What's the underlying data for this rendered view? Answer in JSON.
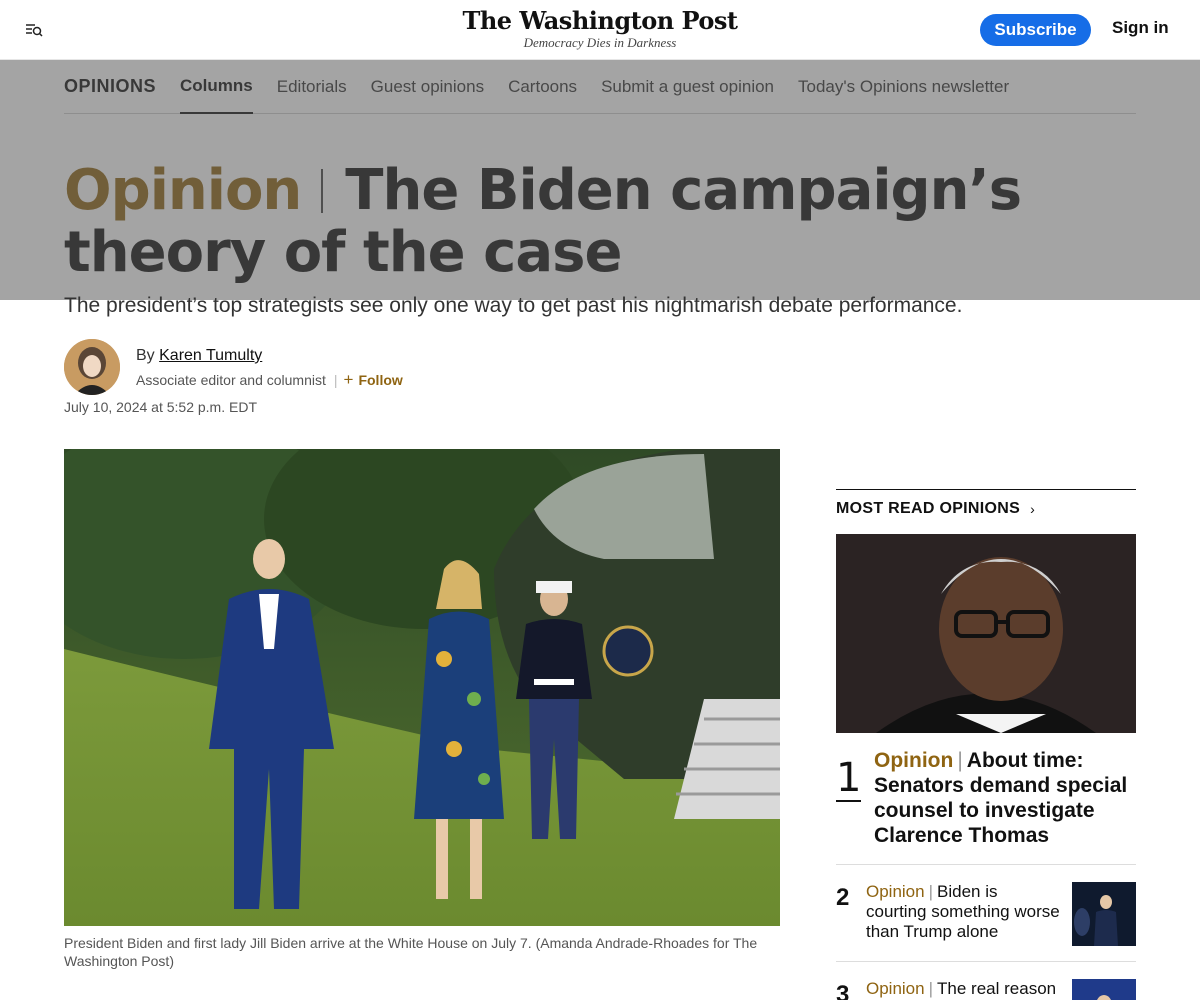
{
  "header": {
    "logo": "The Washington Post",
    "tagline": "Democracy Dies in Darkness",
    "subscribe_label": "Subscribe",
    "signin_label": "Sign in"
  },
  "section_nav": {
    "title": "OPINIONS",
    "items": [
      {
        "label": "Columns",
        "active": true
      },
      {
        "label": "Editorials"
      },
      {
        "label": "Guest opinions"
      },
      {
        "label": "Cartoons"
      },
      {
        "label": "Submit a guest opinion"
      },
      {
        "label": "Today's Opinions newsletter"
      }
    ]
  },
  "article": {
    "kicker": "Opinion",
    "headline": "The Biden campaign’s theory of the case",
    "dek": "The president’s top strategists see only one way to get past his nightmarish debate performance.",
    "byline_prefix": "By",
    "author": "Karen Tumulty",
    "role": "Associate editor and columnist",
    "follow_label": "Follow",
    "date": "July 10, 2024 at 5:52 p.m. EDT",
    "caption": "President Biden and first lady Jill Biden arrive at the White House on July 7. (Amanda Andrade-Rhoades for The Washington Post)"
  },
  "sidebar": {
    "heading": "MOST READ OPINIONS",
    "items": [
      {
        "rank": "1",
        "kicker": "Opinion",
        "title": "About time: Senators demand special counsel to investigate Clarence Thomas"
      },
      {
        "rank": "2",
        "kicker": "Opinion",
        "title": "Biden is courting something worse than Trump alone"
      },
      {
        "rank": "3",
        "kicker": "Opinion",
        "title": "The real reason"
      }
    ]
  },
  "colors": {
    "brand_blue": "#166de7",
    "opinion_gold": "#8f6412"
  }
}
